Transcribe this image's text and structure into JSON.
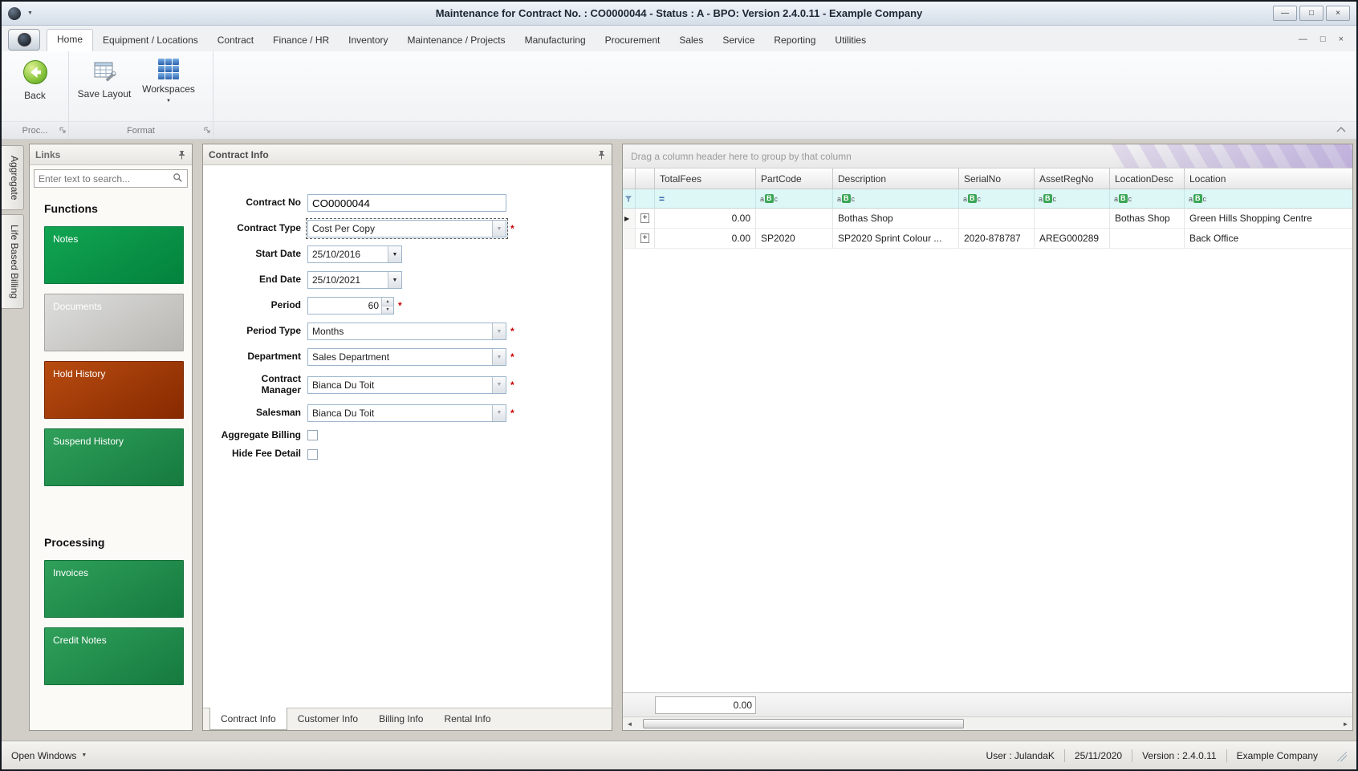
{
  "titlebar": {
    "title": "Maintenance for Contract No. : CO0000044 - Status : A - BPO: Version 2.4.0.11 - Example Company"
  },
  "ribbon": {
    "tabs": [
      "Home",
      "Equipment / Locations",
      "Contract",
      "Finance / HR",
      "Inventory",
      "Maintenance / Projects",
      "Manufacturing",
      "Procurement",
      "Sales",
      "Service",
      "Reporting",
      "Utilities"
    ],
    "active_tab": "Home",
    "back_label": "Back",
    "save_layout_label": "Save Layout",
    "workspaces_label": "Workspaces",
    "group_proc_label": "Proc...",
    "group_format_label": "Format"
  },
  "side_tabs": {
    "aggregate": "Aggregate",
    "life_based_billing": "Life Based Billing"
  },
  "links": {
    "panel_title": "Links",
    "search_placeholder": "Enter text to search...",
    "functions_heading": "Functions",
    "processing_heading": "Processing",
    "function_buttons": [
      "Notes",
      "Documents",
      "Hold History",
      "Suspend History"
    ],
    "processing_buttons": [
      "Invoices",
      "Credit Notes"
    ]
  },
  "contract": {
    "panel_title": "Contract Info",
    "required_marker": "*",
    "fields": {
      "contract_no": {
        "label": "Contract No",
        "value": "CO0000044"
      },
      "contract_type": {
        "label": "Contract Type",
        "value": "Cost Per Copy"
      },
      "start_date": {
        "label": "Start Date",
        "value": "25/10/2016"
      },
      "end_date": {
        "label": "End Date",
        "value": "25/10/2021"
      },
      "period": {
        "label": "Period",
        "value": "60"
      },
      "period_type": {
        "label": "Period Type",
        "value": "Months"
      },
      "department": {
        "label": "Department",
        "value": "Sales Department"
      },
      "contract_manager": {
        "label": "Contract Manager",
        "value": "Bianca Du Toit"
      },
      "salesman": {
        "label": "Salesman",
        "value": "Bianca Du Toit"
      },
      "aggregate_billing": {
        "label": "Aggregate Billing",
        "checked": false
      },
      "hide_fee_detail": {
        "label": "Hide Fee Detail",
        "checked": false
      }
    },
    "tabs": [
      "Contract Info",
      "Customer Info",
      "Billing Info",
      "Rental Info"
    ],
    "active_tab": "Contract Info"
  },
  "grid": {
    "group_hint": "Drag a column header here to group by that column",
    "columns": [
      "TotalFees",
      "PartCode",
      "Description",
      "SerialNo",
      "AssetRegNo",
      "LocationDesc",
      "Location"
    ],
    "rows": [
      {
        "total_fees": "0.00",
        "part_code": "",
        "description": "Bothas Shop",
        "serial_no": "",
        "asset_reg_no": "",
        "location_desc": "Bothas Shop",
        "location": "Green Hills Shopping Centre"
      },
      {
        "total_fees": "0.00",
        "part_code": "SP2020",
        "description": "SP2020 Sprint Colour ...",
        "serial_no": "2020-878787",
        "asset_reg_no": "AREG000289",
        "location_desc": "",
        "location": "Back Office"
      }
    ],
    "footer_total": "0.00"
  },
  "statusbar": {
    "open_windows": "Open Windows",
    "user": "User : JulandaK",
    "date": "25/11/2020",
    "version": "Version : 2.4.0.11",
    "company": "Example Company"
  },
  "icons": {
    "combo_arrow": "▼",
    "spin_up": "▲",
    "spin_down": "▼",
    "expand_plus": "+",
    "row_focus_arrow": "▶",
    "filter_equals": "=",
    "abc_a": "a",
    "abc_b": "B",
    "abc_c": "c",
    "caret_down": "▼",
    "minimize": "—",
    "restore": "□",
    "close": "×",
    "scroll_left": "◄",
    "scroll_right": "►"
  },
  "colors": {
    "green_button": "#0b9d4c",
    "rust_button": "#a63a00",
    "silver_button": "#c9c8c5",
    "filter_row_bg": "#ddf6f6",
    "titlebar_top": "#f1f5fa"
  }
}
